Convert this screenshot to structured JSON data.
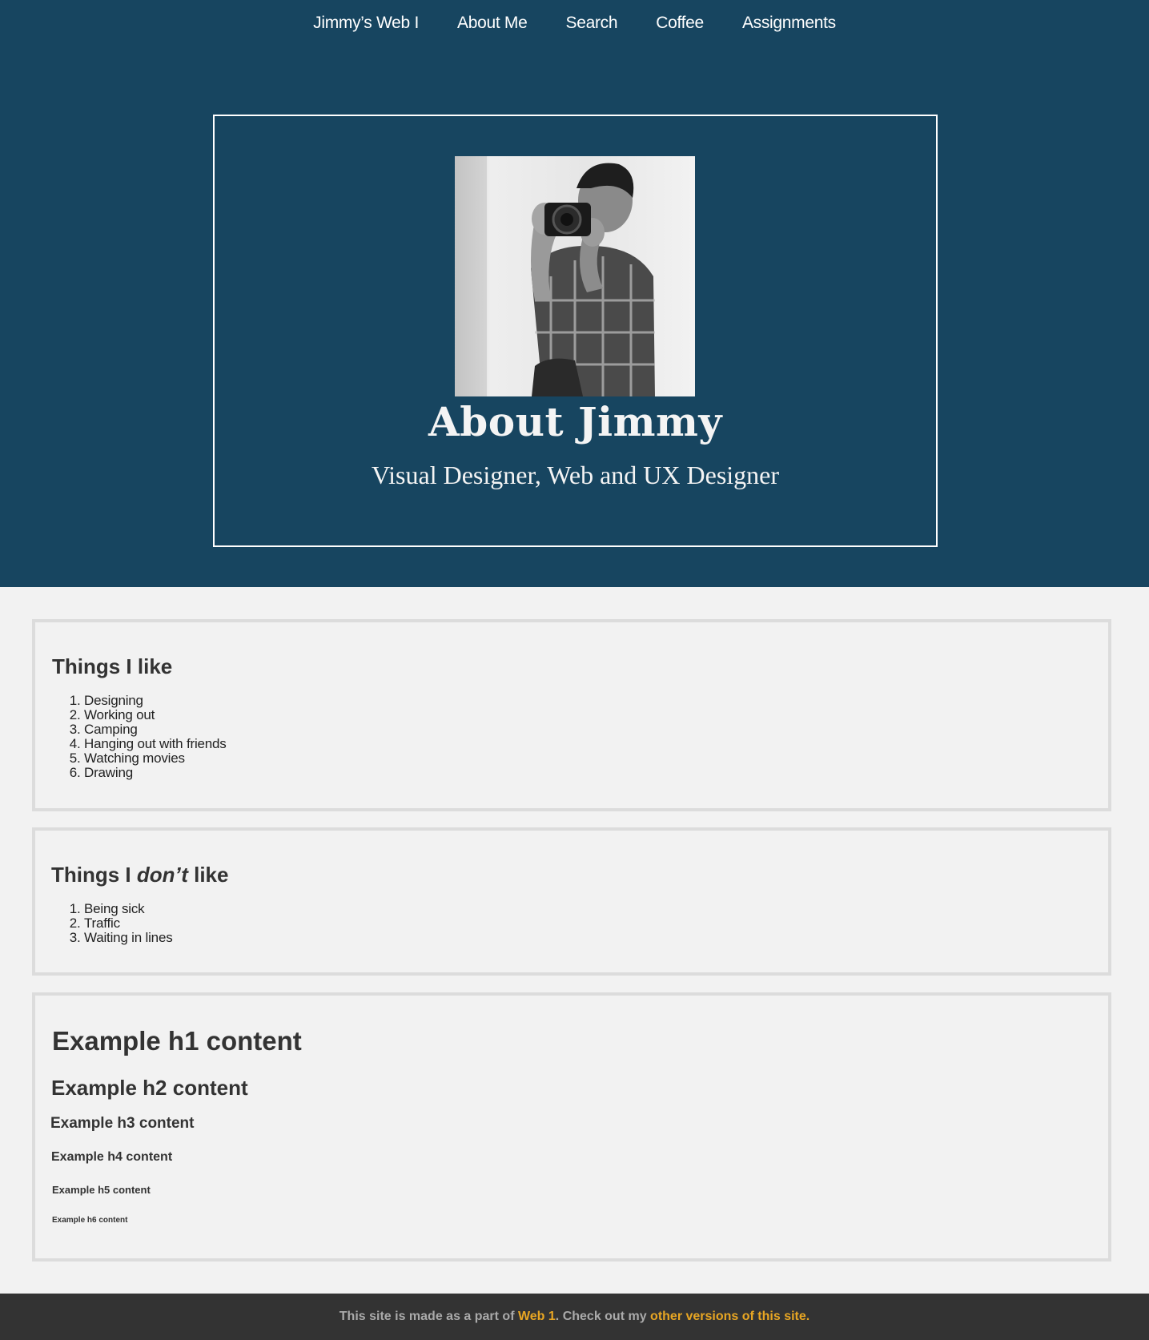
{
  "nav": {
    "items": [
      {
        "label": "Jimmy’s Web I"
      },
      {
        "label": "About Me"
      },
      {
        "label": "Search"
      },
      {
        "label": "Coffee"
      },
      {
        "label": "Assignments"
      }
    ]
  },
  "hero": {
    "title": "About Jimmy",
    "subtitle": "Visual Designer, Web and UX Designer"
  },
  "likes": {
    "heading": "Things I like",
    "items": [
      "Designing",
      "Working out",
      "Camping",
      "Hanging out with friends",
      "Watching movies",
      "Drawing"
    ]
  },
  "dislikes": {
    "heading_before": "Things I ",
    "heading_emphasis": "don’t",
    "heading_after": " like",
    "items": [
      "Being sick",
      "Traffic",
      "Waiting in lines"
    ]
  },
  "headings": {
    "h1": "Example h1 content",
    "h2": "Example h2 content",
    "h3": "Example h3 content",
    "h4": "Example h4 content",
    "h5": "Example h5 content",
    "h6": "Example h6 content"
  },
  "footer": {
    "text_before": "This site is made as a part of ",
    "link1": "Web 1",
    "text_middle": ". Check out my ",
    "link2": "other versions of this site."
  },
  "colors": {
    "hero_bg": "#174560",
    "page_bg": "#f2f2f2",
    "footer_bg": "#333333",
    "accent": "#e8a623",
    "card_border": "#dcdcdc"
  },
  "icons": {
    "portrait": "photographer-portrait-image"
  }
}
